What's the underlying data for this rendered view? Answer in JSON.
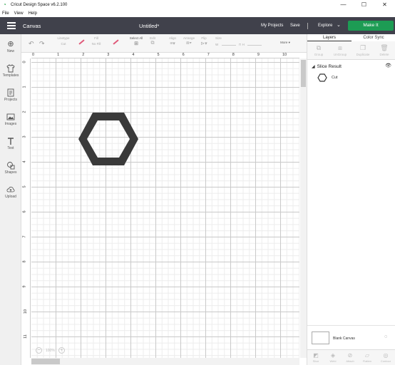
{
  "window": {
    "title": "Cricut Design Space  v6.2.100",
    "minimize": "—",
    "maximize": "☐",
    "close": "✕"
  },
  "menu": [
    "File",
    "View",
    "Help"
  ],
  "header": {
    "section": "Canvas",
    "doc_title": "Untitled*",
    "my_projects": "My Projects",
    "save": "Save",
    "explore": "Explore",
    "make_it": "Make It",
    "accent_color": "#1d9c54"
  },
  "sidebar": [
    {
      "label": "New",
      "icon": "plus-circle-icon"
    },
    {
      "label": "Templates",
      "icon": "tshirt-icon"
    },
    {
      "label": "Projects",
      "icon": "projects-icon"
    },
    {
      "label": "Images",
      "icon": "images-icon"
    },
    {
      "label": "Text",
      "icon": "text-icon"
    },
    {
      "label": "Shapes",
      "icon": "shapes-icon"
    },
    {
      "label": "Upload",
      "icon": "cloud-upload-icon"
    }
  ],
  "toolbar": {
    "linetype": {
      "label": "Linetype",
      "value": "Cut"
    },
    "fill": {
      "label": "Fill",
      "value": "No Fill"
    },
    "select_all": {
      "label": "Select All"
    },
    "edit": {
      "label": "Edit"
    },
    "align": {
      "label": "Align"
    },
    "arrange": {
      "label": "Arrange"
    },
    "flip": {
      "label": "Flip"
    },
    "size": {
      "label": "Size",
      "w": "W",
      "h": "H"
    },
    "more": {
      "label": "More ▾"
    }
  },
  "ruler": {
    "horizontal": [
      "0",
      "1",
      "2",
      "3",
      "4",
      "5",
      "6",
      "7",
      "8",
      "9",
      "10"
    ],
    "vertical": [
      "0",
      "1",
      "2",
      "3",
      "4",
      "5",
      "6",
      "7",
      "8",
      "9",
      "10",
      "11"
    ]
  },
  "canvas": {
    "zoom": "100%",
    "zoom_out": "−",
    "zoom_in": "+",
    "shape": "hexagon",
    "shape_color": "#3a3a3a"
  },
  "panel": {
    "tabs": [
      "Layers",
      "Color Sync"
    ],
    "tools": [
      "Group",
      "UnGroup",
      "Duplicate",
      "Delete"
    ],
    "group_title": "Slice Result",
    "layers": [
      {
        "label": "Cut",
        "icon": "hexagon-icon"
      }
    ],
    "blank_canvas": "Blank Canvas",
    "bottom_tools": [
      "Slice",
      "Weld",
      "Attach",
      "Flatten",
      "Contour"
    ]
  }
}
